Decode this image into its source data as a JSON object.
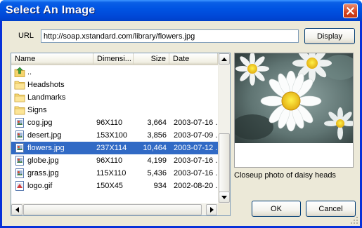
{
  "window": {
    "title": "Select An Image"
  },
  "url": {
    "label": "URL",
    "value": "http://soap.xstandard.com/library/flowers.jpg"
  },
  "buttons": {
    "display": "Display",
    "ok": "OK",
    "cancel": "Cancel"
  },
  "list": {
    "columns": [
      "Name",
      "Dimensi...",
      "Size",
      "Date"
    ],
    "rows": [
      {
        "icon": "up-folder-icon",
        "name": "..",
        "dimensions": "",
        "size": "",
        "date": "",
        "selected": false
      },
      {
        "icon": "folder-icon",
        "name": "Headshots",
        "dimensions": "",
        "size": "",
        "date": "",
        "selected": false
      },
      {
        "icon": "folder-icon",
        "name": "Landmarks",
        "dimensions": "",
        "size": "",
        "date": "",
        "selected": false
      },
      {
        "icon": "folder-icon",
        "name": "Signs",
        "dimensions": "",
        "size": "",
        "date": "",
        "selected": false
      },
      {
        "icon": "image-file-icon",
        "name": "cog.jpg",
        "dimensions": "96X110",
        "size": "3,664",
        "date": "2003-07-16 ...",
        "selected": false
      },
      {
        "icon": "image-file-icon",
        "name": "desert.jpg",
        "dimensions": "153X100",
        "size": "3,856",
        "date": "2003-07-09 ...",
        "selected": false
      },
      {
        "icon": "image-file-icon",
        "name": "flowers.jpg",
        "dimensions": "237X114",
        "size": "10,464",
        "date": "2003-07-12 ...",
        "selected": true
      },
      {
        "icon": "image-file-icon",
        "name": "globe.jpg",
        "dimensions": "96X110",
        "size": "4,199",
        "date": "2003-07-16 ...",
        "selected": false
      },
      {
        "icon": "image-file-icon",
        "name": "grass.jpg",
        "dimensions": "115X110",
        "size": "5,436",
        "date": "2003-07-16 ...",
        "selected": false
      },
      {
        "icon": "gif-file-icon",
        "name": "logo.gif",
        "dimensions": "150X45",
        "size": "934",
        "date": "2002-08-20 ...",
        "selected": false
      }
    ]
  },
  "preview": {
    "caption": "Closeup photo of daisy heads"
  },
  "colors": {
    "selection": "#316ac5",
    "title_bar": "#0054e3",
    "dialog_bg": "#ece9d8"
  }
}
